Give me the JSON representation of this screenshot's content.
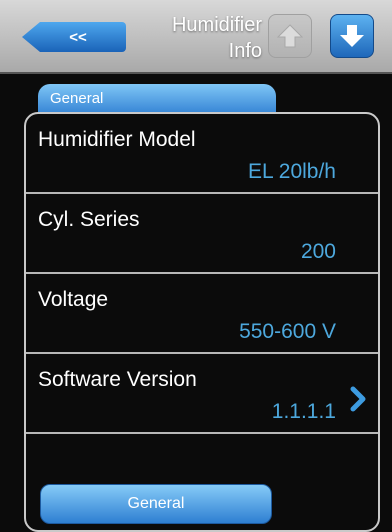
{
  "header": {
    "back_label": "<<",
    "title_line1": "Humidifier",
    "title_line2": "Info",
    "up_icon": "arrow-up-icon",
    "down_icon": "arrow-down-icon"
  },
  "tabs": {
    "top": "General",
    "bottom": "General"
  },
  "rows": [
    {
      "label": "Humidifier Model",
      "value": "EL 20lb/h"
    },
    {
      "label": "Cyl. Series",
      "value": "200"
    },
    {
      "label": "Voltage",
      "value": "550-600 V"
    },
    {
      "label": "Software Version",
      "value": "1.1.1.1",
      "has_detail": true
    }
  ],
  "colors": {
    "accent_blue": "#4da8dd",
    "header_bg": "#c0c0c0"
  }
}
